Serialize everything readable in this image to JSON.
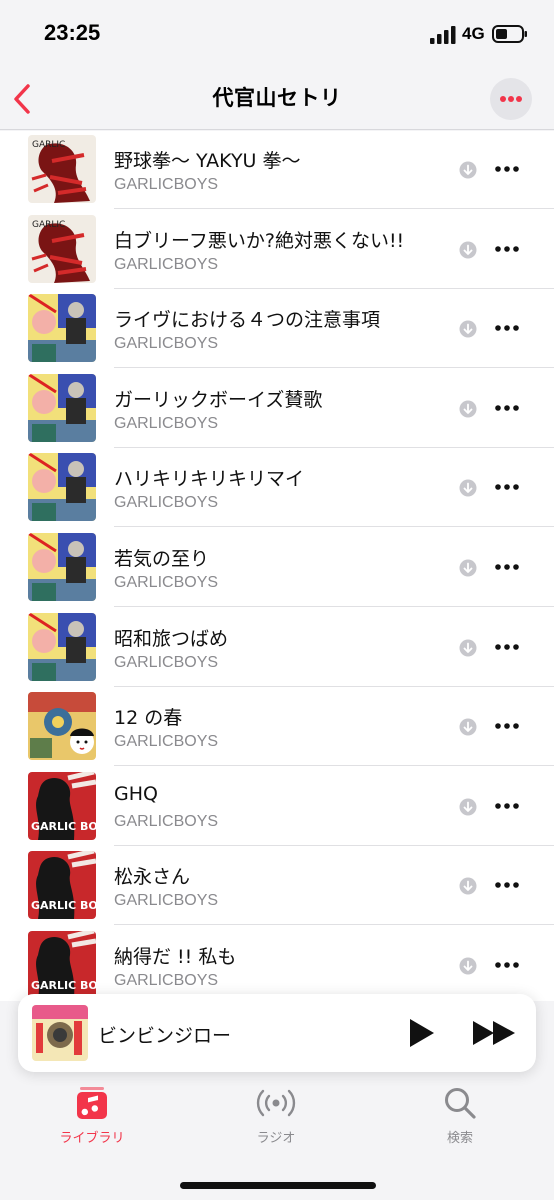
{
  "status_bar": {
    "time": "23:25",
    "network": "4G"
  },
  "nav": {
    "title": "代官山セトリ"
  },
  "tracks": [
    {
      "title": "野球拳〜 YAKYU 拳〜",
      "artist": "GARLICBOYS",
      "art": "a"
    },
    {
      "title": "白ブリーフ悪いか?絶対悪くない!!",
      "artist": "GARLICBOYS",
      "art": "a"
    },
    {
      "title": "ライヴにおける４つの注意事項",
      "artist": "GARLICBOYS",
      "art": "b"
    },
    {
      "title": "ガーリックボーイズ賛歌",
      "artist": "GARLICBOYS",
      "art": "b"
    },
    {
      "title": "ハリキリキリキリマイ",
      "artist": "GARLICBOYS",
      "art": "b"
    },
    {
      "title": "若気の至り",
      "artist": "GARLICBOYS",
      "art": "b"
    },
    {
      "title": "昭和旅つばめ",
      "artist": "GARLICBOYS",
      "art": "b"
    },
    {
      "title": "12 の春",
      "artist": "GARLICBOYS",
      "art": "c"
    },
    {
      "title": "GHQ",
      "artist": "GARLICBOYS",
      "art": "d"
    },
    {
      "title": "松永さん",
      "artist": "GARLICBOYS",
      "art": "d"
    },
    {
      "title": "納得だ !! 私も",
      "artist": "GARLICBOYS",
      "art": "d"
    }
  ],
  "now_playing": {
    "title": "ビンビンジロー"
  },
  "tabs": [
    {
      "label": "ライブラリ",
      "icon": "music-note-icon",
      "active": true
    },
    {
      "label": "ラジオ",
      "icon": "radio-icon",
      "active": false
    },
    {
      "label": "検索",
      "icon": "search-icon",
      "active": false
    }
  ],
  "colors": {
    "accent": "#f2354a",
    "muted": "#8a8a8e"
  }
}
